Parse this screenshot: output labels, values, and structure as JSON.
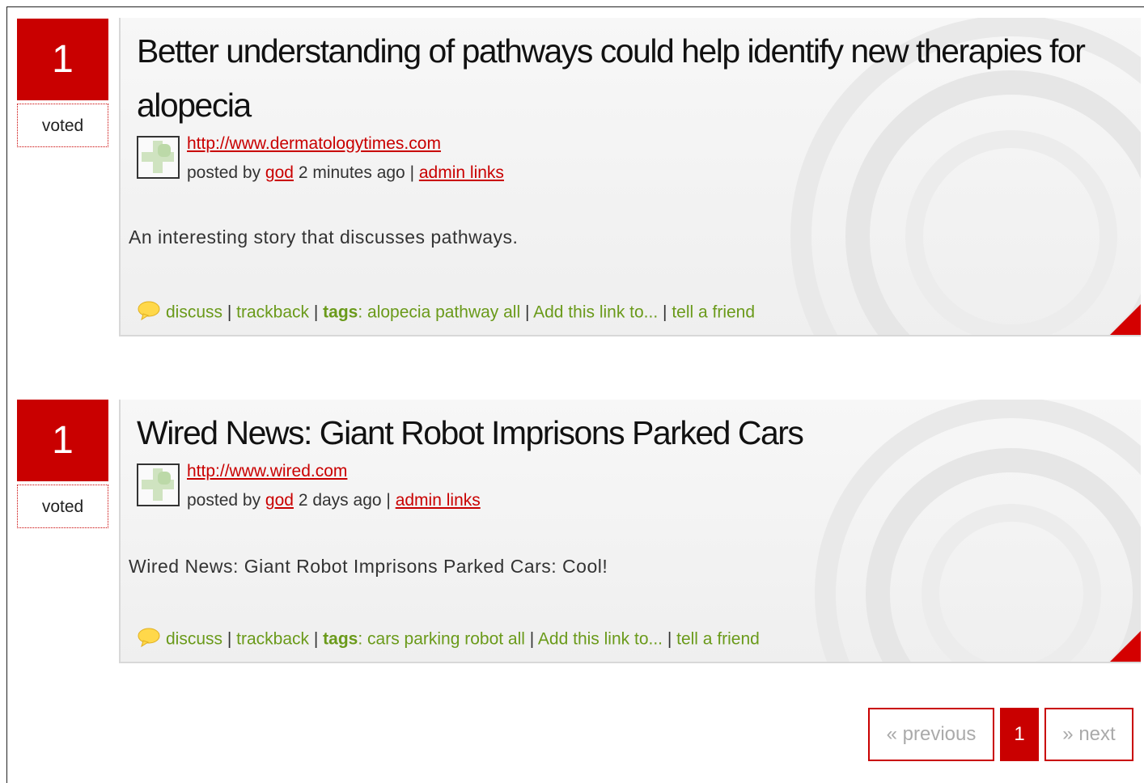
{
  "stories": [
    {
      "votes": "1",
      "vote_label": "voted",
      "title": "Better understanding of pathways could help identify new therapies for alopecia",
      "url": "http://www.dermatologytimes.com",
      "posted_by_prefix": "posted by",
      "author": "god",
      "time": "2 minutes ago |",
      "admin_links": "admin links",
      "description": "An interesting story that discusses pathways.",
      "discuss": "discuss",
      "trackback": "trackback",
      "tags_label": "tags",
      "tags": "alopecia pathway all",
      "add_link": "Add this link to...",
      "tell_friend": "tell a friend"
    },
    {
      "votes": "1",
      "vote_label": "voted",
      "title": "Wired News: Giant Robot Imprisons Parked Cars",
      "url": "http://www.wired.com",
      "posted_by_prefix": "posted by",
      "author": "god",
      "time": "2 days ago |",
      "admin_links": "admin links",
      "description": "Wired News: Giant Robot Imprisons Parked Cars: Cool!",
      "discuss": "discuss",
      "trackback": "trackback",
      "tags_label": "tags",
      "tags": "cars parking robot all",
      "add_link": "Add this link to...",
      "tell_friend": "tell a friend"
    }
  ],
  "pagination": {
    "previous": "« previous",
    "current": "1",
    "next": "» next"
  },
  "colors": {
    "accent": "#c90000",
    "tag_green": "#6a9a1a"
  },
  "icons": {
    "comment": "speech-bubble-icon",
    "thumbnail": "site-thumbnail-icon",
    "corner": "page-corner-icon"
  }
}
